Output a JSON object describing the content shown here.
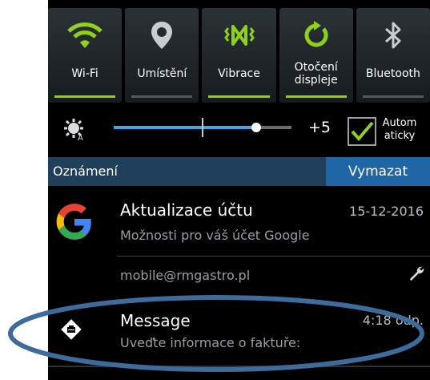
{
  "quick_settings": [
    {
      "label": "Wi-Fi",
      "icon": "wifi-icon",
      "active": true
    },
    {
      "label": "Umístění",
      "icon": "location-icon",
      "active": false
    },
    {
      "label": "Vibrace",
      "icon": "vibrate-icon",
      "active": true
    },
    {
      "label": "Otočení\ndispleje",
      "icon": "rotate-icon",
      "active": true
    },
    {
      "label": "Bluetooth",
      "icon": "bluetooth-icon",
      "active": false
    }
  ],
  "brightness": {
    "level": 0.8,
    "marker": 0.5,
    "plus_label": "+5",
    "auto_label": "Autom aticky",
    "auto_checked": true
  },
  "notifications_header": {
    "title": "Oznámení",
    "clear_label": "Vymazat"
  },
  "notifications": [
    {
      "icon": "google-icon",
      "title": "Aktualizace účtu",
      "subtitle": "Možnosti pro váš účet Google",
      "time": "15-12-2016",
      "account": "mobile@rmgastro.pl"
    },
    {
      "icon": "message-icon",
      "title": "Message",
      "subtitle": "Uveďte informace o faktuře:",
      "time": "4:18 odp."
    }
  ],
  "colors": {
    "accent_green": "#8fd11a",
    "slider_blue": "#3aa9e8",
    "header_blue": "#1f3f5b",
    "button_blue": "#1f66a6",
    "annotation": "#3d6b9c"
  }
}
